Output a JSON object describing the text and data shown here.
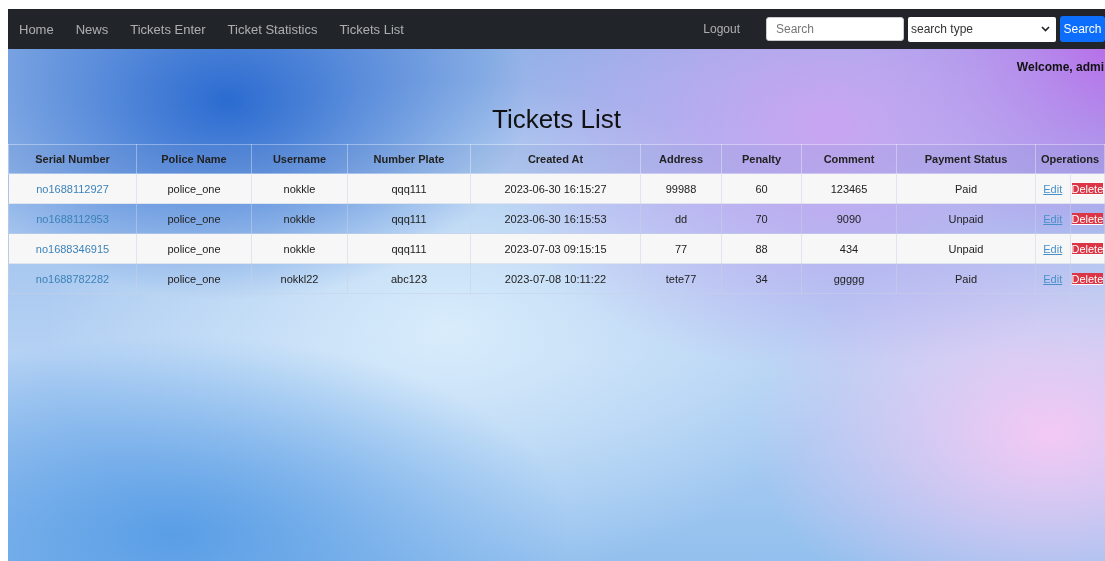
{
  "nav": {
    "links": [
      "Home",
      "News",
      "Tickets Enter",
      "Ticket Statistics",
      "Tickets List"
    ],
    "logout": "Logout",
    "search": {
      "placeholder": "Search"
    },
    "search_type": {
      "value": "search type"
    },
    "search_button": "Search"
  },
  "welcome": "Welcome, admi",
  "title": "Tickets List",
  "table": {
    "columns": [
      "Serial Number",
      "Police Name",
      "Username",
      "Number Plate",
      "Created At",
      "Address",
      "Penalty",
      "Comment",
      "Payment Status",
      "Operations"
    ],
    "rows": [
      {
        "serial": "no1688112927",
        "police": "police_one",
        "username": "nokkle",
        "plate": "qqq111",
        "created": "2023-06-30 16:15:27",
        "address": "99988",
        "penalty": "60",
        "comment": "123465",
        "status": "Paid",
        "edit": "Edit",
        "delete": "Delete"
      },
      {
        "serial": "no1688112953",
        "police": "police_one",
        "username": "nokkle",
        "plate": "qqq111",
        "created": "2023-06-30 16:15:53",
        "address": "dd",
        "penalty": "70",
        "comment": "9090",
        "status": "Unpaid",
        "edit": "Edit",
        "delete": "Delete"
      },
      {
        "serial": "no1688346915",
        "police": "police_one",
        "username": "nokkle",
        "plate": "qqq111",
        "created": "2023-07-03 09:15:15",
        "address": "77",
        "penalty": "88",
        "comment": "434",
        "status": "Unpaid",
        "edit": "Edit",
        "delete": "Delete"
      },
      {
        "serial": "no1688782282",
        "police": "police_one",
        "username": "nokkl22",
        "plate": "abc123",
        "created": "2023-07-08 10:11:22",
        "address": "tete77",
        "penalty": "34",
        "comment": "ggggg",
        "status": "Paid",
        "edit": "Edit",
        "delete": "Delete"
      }
    ]
  }
}
